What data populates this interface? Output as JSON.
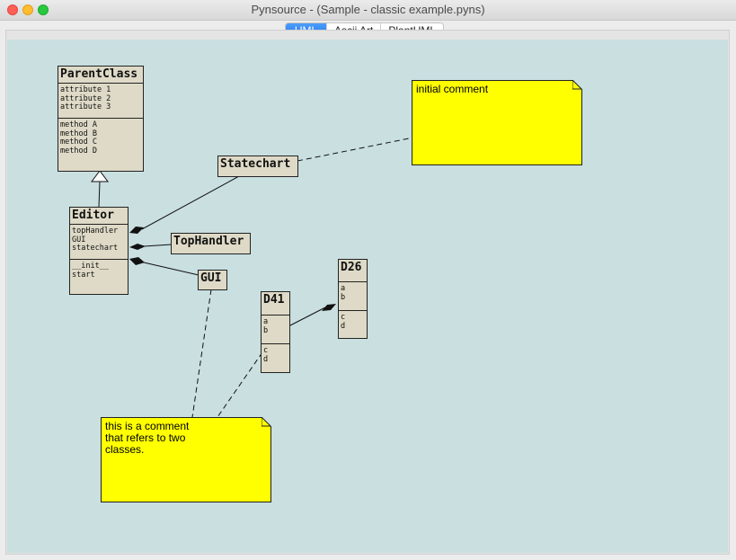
{
  "window": {
    "title": "Pynsource - (Sample - classic example.pyns)"
  },
  "tabs": [
    {
      "label": "UML",
      "active": true
    },
    {
      "label": "Ascii Art",
      "active": false
    },
    {
      "label": "PlantUML",
      "active": false
    }
  ],
  "classes": {
    "parent": {
      "name": "ParentClass",
      "attrs": [
        "attribute 1",
        "attribute 2",
        "attribute 3"
      ],
      "methods": [
        "method A",
        "method B",
        "method C",
        "method D"
      ]
    },
    "editor": {
      "name": "Editor",
      "attrs": [
        "topHandler",
        "GUI",
        "statechart"
      ],
      "methods": [
        "__init__",
        "start"
      ]
    },
    "statechart": {
      "name": "Statechart"
    },
    "tophandler": {
      "name": "TopHandler"
    },
    "gui": {
      "name": "GUI"
    },
    "d41": {
      "name": "D41",
      "attrs": [
        "a",
        "b"
      ],
      "methods": [
        "c",
        "d"
      ]
    },
    "d26": {
      "name": "D26",
      "attrs": [
        "a",
        "b"
      ],
      "methods": [
        "c",
        "d"
      ]
    }
  },
  "notes": {
    "initial": {
      "lines": [
        "initial comment"
      ]
    },
    "refers": {
      "lines": [
        "this is a comment",
        "that refers to two",
        "classes."
      ]
    }
  },
  "colors": {
    "canvas": "#c9dfe0",
    "class_fill": "#dedac7",
    "note_fill": "#ffff00",
    "tab_active": "#1a73e8"
  }
}
